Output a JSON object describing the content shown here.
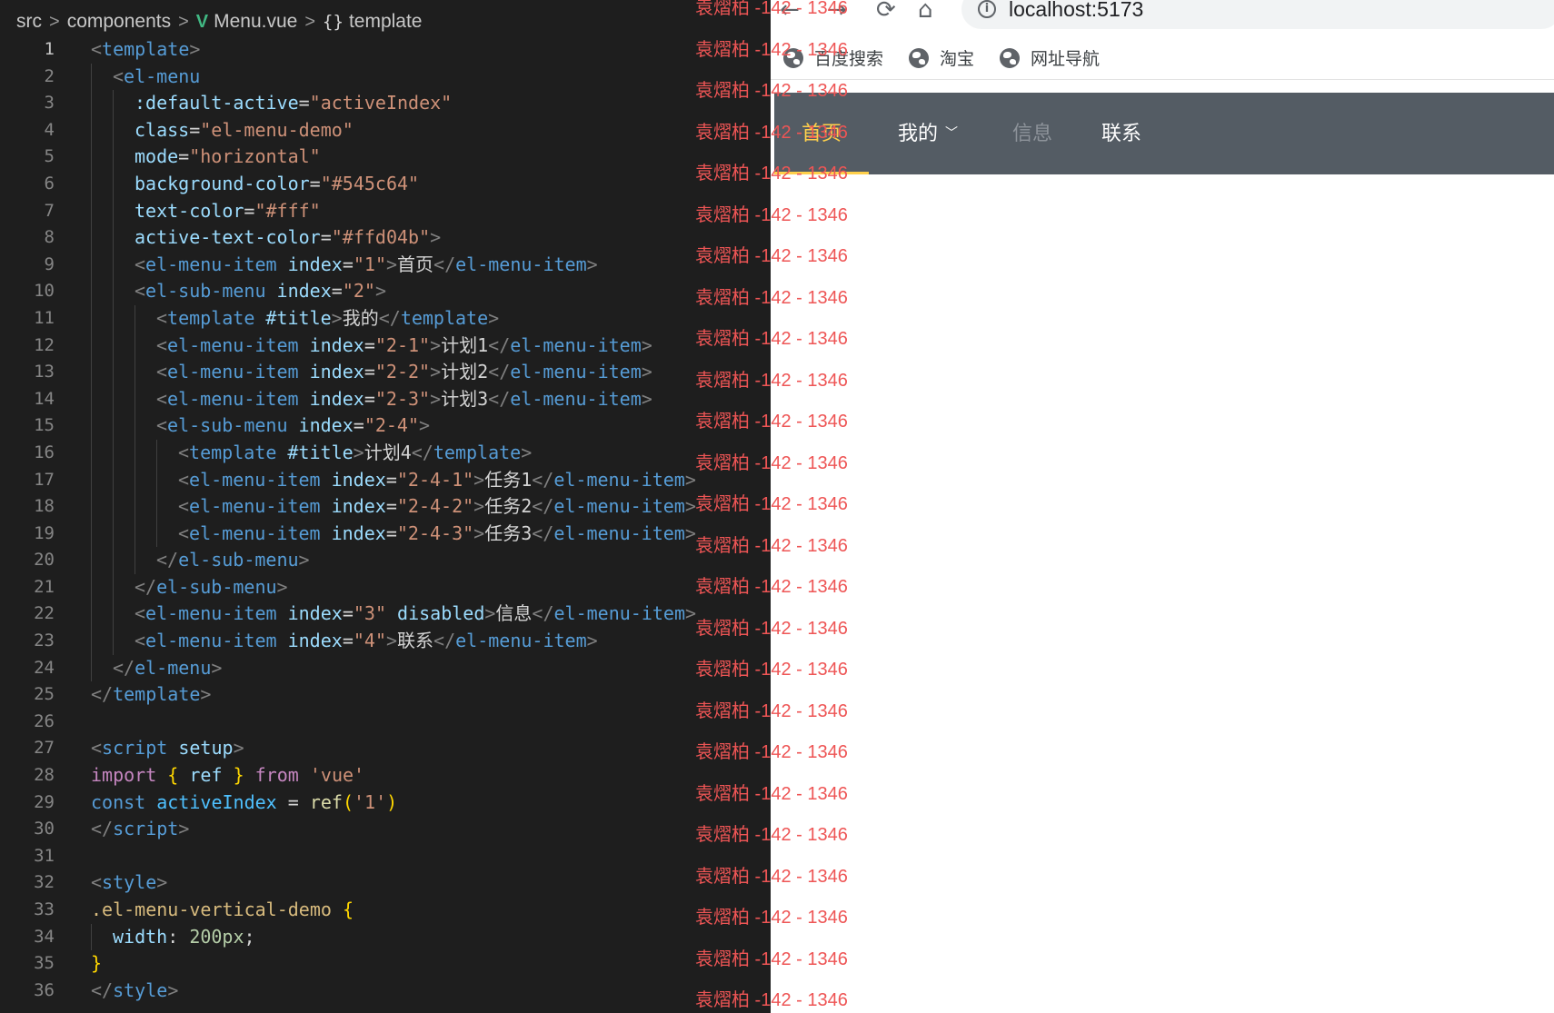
{
  "editor": {
    "breadcrumb": {
      "src": "src",
      "components": "components",
      "file": "Menu.vue",
      "symbol": "template",
      "separator": ">",
      "file_icon": "vue-icon",
      "symbol_icon": "braces-icon"
    },
    "active_line": 1,
    "lines": [
      {
        "n": "1",
        "indent": 0,
        "tokens": [
          [
            "br",
            "<"
          ],
          [
            "tag",
            "template"
          ],
          [
            "br",
            ">"
          ]
        ]
      },
      {
        "n": "2",
        "indent": 1,
        "tokens": [
          [
            "br",
            "<"
          ],
          [
            "tag",
            "el-menu"
          ]
        ]
      },
      {
        "n": "3",
        "indent": 2,
        "tokens": [
          [
            "attr",
            ":default-active"
          ],
          [
            "txt",
            "="
          ],
          [
            "str",
            "\"activeIndex\""
          ]
        ]
      },
      {
        "n": "4",
        "indent": 2,
        "tokens": [
          [
            "attr",
            "class"
          ],
          [
            "txt",
            "="
          ],
          [
            "str",
            "\"el-menu-demo\""
          ]
        ]
      },
      {
        "n": "5",
        "indent": 2,
        "tokens": [
          [
            "attr",
            "mode"
          ],
          [
            "txt",
            "="
          ],
          [
            "str",
            "\"horizontal\""
          ]
        ]
      },
      {
        "n": "6",
        "indent": 2,
        "tokens": [
          [
            "attr",
            "background-color"
          ],
          [
            "txt",
            "="
          ],
          [
            "str",
            "\"#545c64\""
          ]
        ]
      },
      {
        "n": "7",
        "indent": 2,
        "tokens": [
          [
            "attr",
            "text-color"
          ],
          [
            "txt",
            "="
          ],
          [
            "str",
            "\"#fff\""
          ]
        ]
      },
      {
        "n": "8",
        "indent": 2,
        "tokens": [
          [
            "attr",
            "active-text-color"
          ],
          [
            "txt",
            "="
          ],
          [
            "str",
            "\"#ffd04b\""
          ],
          [
            "br",
            ">"
          ]
        ]
      },
      {
        "n": "9",
        "indent": 2,
        "tokens": [
          [
            "br",
            "<"
          ],
          [
            "tag",
            "el-menu-item"
          ],
          [
            "txt",
            " "
          ],
          [
            "attr",
            "index"
          ],
          [
            "txt",
            "="
          ],
          [
            "str",
            "\"1\""
          ],
          [
            "br",
            ">"
          ],
          [
            "txt",
            "首页"
          ],
          [
            "br",
            "</"
          ],
          [
            "tag",
            "el-menu-item"
          ],
          [
            "br",
            ">"
          ]
        ]
      },
      {
        "n": "10",
        "indent": 2,
        "tokens": [
          [
            "br",
            "<"
          ],
          [
            "tag",
            "el-sub-menu"
          ],
          [
            "txt",
            " "
          ],
          [
            "attr",
            "index"
          ],
          [
            "txt",
            "="
          ],
          [
            "str",
            "\"2\""
          ],
          [
            "br",
            ">"
          ]
        ]
      },
      {
        "n": "11",
        "indent": 3,
        "tokens": [
          [
            "br",
            "<"
          ],
          [
            "tag",
            "template"
          ],
          [
            "txt",
            " "
          ],
          [
            "attr",
            "#title"
          ],
          [
            "br",
            ">"
          ],
          [
            "txt",
            "我的"
          ],
          [
            "br",
            "</"
          ],
          [
            "tag",
            "template"
          ],
          [
            "br",
            ">"
          ]
        ]
      },
      {
        "n": "12",
        "indent": 3,
        "tokens": [
          [
            "br",
            "<"
          ],
          [
            "tag",
            "el-menu-item"
          ],
          [
            "txt",
            " "
          ],
          [
            "attr",
            "index"
          ],
          [
            "txt",
            "="
          ],
          [
            "str",
            "\"2-1\""
          ],
          [
            "br",
            ">"
          ],
          [
            "txt",
            "计划1"
          ],
          [
            "br",
            "</"
          ],
          [
            "tag",
            "el-menu-item"
          ],
          [
            "br",
            ">"
          ]
        ]
      },
      {
        "n": "13",
        "indent": 3,
        "tokens": [
          [
            "br",
            "<"
          ],
          [
            "tag",
            "el-menu-item"
          ],
          [
            "txt",
            " "
          ],
          [
            "attr",
            "index"
          ],
          [
            "txt",
            "="
          ],
          [
            "str",
            "\"2-2\""
          ],
          [
            "br",
            ">"
          ],
          [
            "txt",
            "计划2"
          ],
          [
            "br",
            "</"
          ],
          [
            "tag",
            "el-menu-item"
          ],
          [
            "br",
            ">"
          ]
        ]
      },
      {
        "n": "14",
        "indent": 3,
        "tokens": [
          [
            "br",
            "<"
          ],
          [
            "tag",
            "el-menu-item"
          ],
          [
            "txt",
            " "
          ],
          [
            "attr",
            "index"
          ],
          [
            "txt",
            "="
          ],
          [
            "str",
            "\"2-3\""
          ],
          [
            "br",
            ">"
          ],
          [
            "txt",
            "计划3"
          ],
          [
            "br",
            "</"
          ],
          [
            "tag",
            "el-menu-item"
          ],
          [
            "br",
            ">"
          ]
        ]
      },
      {
        "n": "15",
        "indent": 3,
        "tokens": [
          [
            "br",
            "<"
          ],
          [
            "tag",
            "el-sub-menu"
          ],
          [
            "txt",
            " "
          ],
          [
            "attr",
            "index"
          ],
          [
            "txt",
            "="
          ],
          [
            "str",
            "\"2-4\""
          ],
          [
            "br",
            ">"
          ]
        ]
      },
      {
        "n": "16",
        "indent": 4,
        "tokens": [
          [
            "br",
            "<"
          ],
          [
            "tag",
            "template"
          ],
          [
            "txt",
            " "
          ],
          [
            "attr",
            "#title"
          ],
          [
            "br",
            ">"
          ],
          [
            "txt",
            "计划4"
          ],
          [
            "br",
            "</"
          ],
          [
            "tag",
            "template"
          ],
          [
            "br",
            ">"
          ]
        ]
      },
      {
        "n": "17",
        "indent": 4,
        "tokens": [
          [
            "br",
            "<"
          ],
          [
            "tag",
            "el-menu-item"
          ],
          [
            "txt",
            " "
          ],
          [
            "attr",
            "index"
          ],
          [
            "txt",
            "="
          ],
          [
            "str",
            "\"2-4-1\""
          ],
          [
            "br",
            ">"
          ],
          [
            "txt",
            "任务1"
          ],
          [
            "br",
            "</"
          ],
          [
            "tag",
            "el-menu-item"
          ],
          [
            "br",
            ">"
          ]
        ]
      },
      {
        "n": "18",
        "indent": 4,
        "tokens": [
          [
            "br",
            "<"
          ],
          [
            "tag",
            "el-menu-item"
          ],
          [
            "txt",
            " "
          ],
          [
            "attr",
            "index"
          ],
          [
            "txt",
            "="
          ],
          [
            "str",
            "\"2-4-2\""
          ],
          [
            "br",
            ">"
          ],
          [
            "txt",
            "任务2"
          ],
          [
            "br",
            "</"
          ],
          [
            "tag",
            "el-menu-item"
          ],
          [
            "br",
            ">"
          ]
        ]
      },
      {
        "n": "19",
        "indent": 4,
        "tokens": [
          [
            "br",
            "<"
          ],
          [
            "tag",
            "el-menu-item"
          ],
          [
            "txt",
            " "
          ],
          [
            "attr",
            "index"
          ],
          [
            "txt",
            "="
          ],
          [
            "str",
            "\"2-4-3\""
          ],
          [
            "br",
            ">"
          ],
          [
            "txt",
            "任务3"
          ],
          [
            "br",
            "</"
          ],
          [
            "tag",
            "el-menu-item"
          ],
          [
            "br",
            ">"
          ]
        ]
      },
      {
        "n": "20",
        "indent": 3,
        "tokens": [
          [
            "br",
            "</"
          ],
          [
            "tag",
            "el-sub-menu"
          ],
          [
            "br",
            ">"
          ]
        ]
      },
      {
        "n": "21",
        "indent": 2,
        "tokens": [
          [
            "br",
            "</"
          ],
          [
            "tag",
            "el-sub-menu"
          ],
          [
            "br",
            ">"
          ]
        ]
      },
      {
        "n": "22",
        "indent": 2,
        "tokens": [
          [
            "br",
            "<"
          ],
          [
            "tag",
            "el-menu-item"
          ],
          [
            "txt",
            " "
          ],
          [
            "attr",
            "index"
          ],
          [
            "txt",
            "="
          ],
          [
            "str",
            "\"3\""
          ],
          [
            "txt",
            " "
          ],
          [
            "attr",
            "disabled"
          ],
          [
            "br",
            ">"
          ],
          [
            "txt",
            "信息"
          ],
          [
            "br",
            "</"
          ],
          [
            "tag",
            "el-menu-item"
          ],
          [
            "br",
            ">"
          ]
        ]
      },
      {
        "n": "23",
        "indent": 2,
        "tokens": [
          [
            "br",
            "<"
          ],
          [
            "tag",
            "el-menu-item"
          ],
          [
            "txt",
            " "
          ],
          [
            "attr",
            "index"
          ],
          [
            "txt",
            "="
          ],
          [
            "str",
            "\"4\""
          ],
          [
            "br",
            ">"
          ],
          [
            "txt",
            "联系"
          ],
          [
            "br",
            "</"
          ],
          [
            "tag",
            "el-menu-item"
          ],
          [
            "br",
            ">"
          ]
        ]
      },
      {
        "n": "24",
        "indent": 1,
        "tokens": [
          [
            "br",
            "</"
          ],
          [
            "tag",
            "el-menu"
          ],
          [
            "br",
            ">"
          ]
        ]
      },
      {
        "n": "25",
        "indent": 0,
        "tokens": [
          [
            "br",
            "</"
          ],
          [
            "tag",
            "template"
          ],
          [
            "br",
            ">"
          ]
        ]
      },
      {
        "n": "26",
        "indent": 0,
        "tokens": []
      },
      {
        "n": "27",
        "indent": 0,
        "tokens": [
          [
            "br",
            "<"
          ],
          [
            "tag",
            "script"
          ],
          [
            "txt",
            " "
          ],
          [
            "attr",
            "setup"
          ],
          [
            "br",
            ">"
          ]
        ]
      },
      {
        "n": "28",
        "indent": 0,
        "tokens": [
          [
            "kw",
            "import"
          ],
          [
            "txt",
            " "
          ],
          [
            "brace",
            "{"
          ],
          [
            "txt",
            " "
          ],
          [
            "attr",
            "ref"
          ],
          [
            "txt",
            " "
          ],
          [
            "brace",
            "}"
          ],
          [
            "txt",
            " "
          ],
          [
            "kw",
            "from"
          ],
          [
            "txt",
            " "
          ],
          [
            "str",
            "'vue'"
          ]
        ]
      },
      {
        "n": "29",
        "indent": 0,
        "tokens": [
          [
            "dec",
            "const"
          ],
          [
            "txt",
            " "
          ],
          [
            "var",
            "activeIndex"
          ],
          [
            "txt",
            " = "
          ],
          [
            "fn",
            "ref"
          ],
          [
            "brace",
            "("
          ],
          [
            "str",
            "'1'"
          ],
          [
            "brace",
            ")"
          ]
        ]
      },
      {
        "n": "30",
        "indent": 0,
        "tokens": [
          [
            "br",
            "</"
          ],
          [
            "tag",
            "script"
          ],
          [
            "br",
            ">"
          ]
        ]
      },
      {
        "n": "31",
        "indent": 0,
        "tokens": []
      },
      {
        "n": "32",
        "indent": 0,
        "tokens": [
          [
            "br",
            "<"
          ],
          [
            "tag",
            "style"
          ],
          [
            "br",
            ">"
          ]
        ]
      },
      {
        "n": "33",
        "indent": 0,
        "tokens": [
          [
            "sel",
            ".el-menu-vertical-demo"
          ],
          [
            "txt",
            " "
          ],
          [
            "brace",
            "{"
          ]
        ]
      },
      {
        "n": "34",
        "indent": 1,
        "tokens": [
          [
            "attr",
            "width"
          ],
          [
            "txt",
            ": "
          ],
          [
            "num",
            "200px"
          ],
          [
            "txt",
            ";"
          ]
        ]
      },
      {
        "n": "35",
        "indent": 0,
        "tokens": [
          [
            "brace",
            "}"
          ]
        ]
      },
      {
        "n": "36",
        "indent": 0,
        "tokens": [
          [
            "br",
            "</"
          ],
          [
            "tag",
            "style"
          ],
          [
            "br",
            ">"
          ]
        ]
      }
    ]
  },
  "watermark": {
    "text": "袁熠柏 -142 - 1346",
    "repeat": 25,
    "color": "#ee5555"
  },
  "browser": {
    "nav": {
      "back": "←",
      "forward": "→",
      "reload": "⟳",
      "home": "⌂"
    },
    "address": {
      "url": "localhost:5173",
      "info_icon": "info-icon"
    },
    "bookmarks": [
      {
        "label": "百度搜索",
        "icon": "globe-icon"
      },
      {
        "label": "淘宝",
        "icon": "globe-icon"
      },
      {
        "label": "网址导航",
        "icon": "globe-icon"
      }
    ],
    "menu": {
      "background": "#545c64",
      "text_color": "#ffffff",
      "active_text_color": "#ffd04b",
      "items": [
        {
          "label": "首页",
          "state": "active"
        },
        {
          "label": "我的",
          "state": "submenu",
          "icon": "chevron-down-icon",
          "arrow": "﹀"
        },
        {
          "label": "信息",
          "state": "disabled"
        },
        {
          "label": "联系",
          "state": "normal"
        }
      ]
    }
  }
}
